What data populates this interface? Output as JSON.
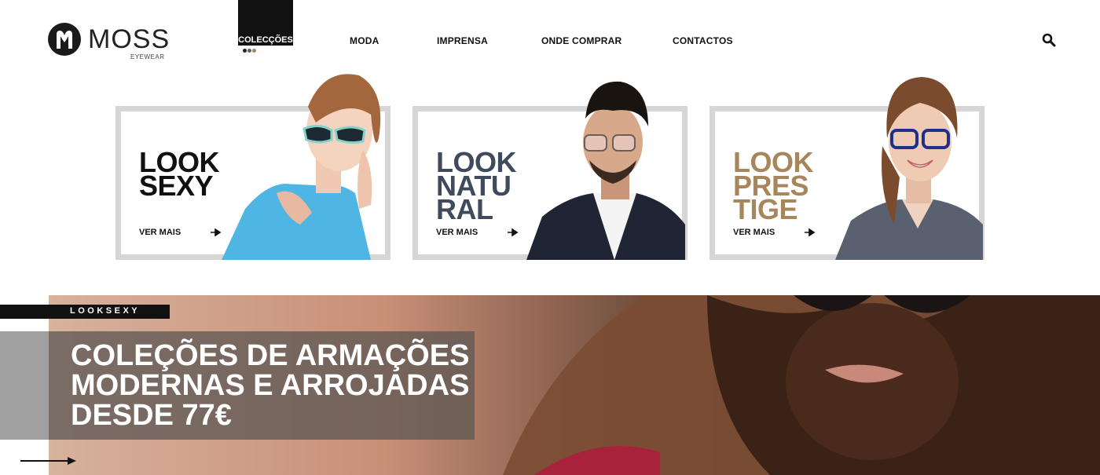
{
  "brand": {
    "name": "MOSS",
    "subtitle": "EYEWEAR"
  },
  "nav": {
    "active": "COLECÇÕES",
    "items": [
      "MODA",
      "IMPRENSA",
      "ONDE COMPRAR",
      "CONTACTOS"
    ],
    "dot_colors": [
      "#222222",
      "#556070",
      "#a8865c"
    ],
    "search_icon": "search-icon"
  },
  "cards": [
    {
      "title": "LOOK\nSEXY",
      "link": "VER MAIS",
      "color": "#111111"
    },
    {
      "title": "LOOK\nNATU\nRAL",
      "link": "VER MAIS",
      "color": "#3f4b5c"
    },
    {
      "title": "LOOK\nPRES\nTIGE",
      "link": "VER MAIS",
      "color": "#a8865c"
    }
  ],
  "banner": {
    "tag": "LOOKSEXY",
    "headline": "COLEÇÕES DE ARMAÇÕES\nMODERNAS E ARROJADAS\nDESDE 77€"
  }
}
